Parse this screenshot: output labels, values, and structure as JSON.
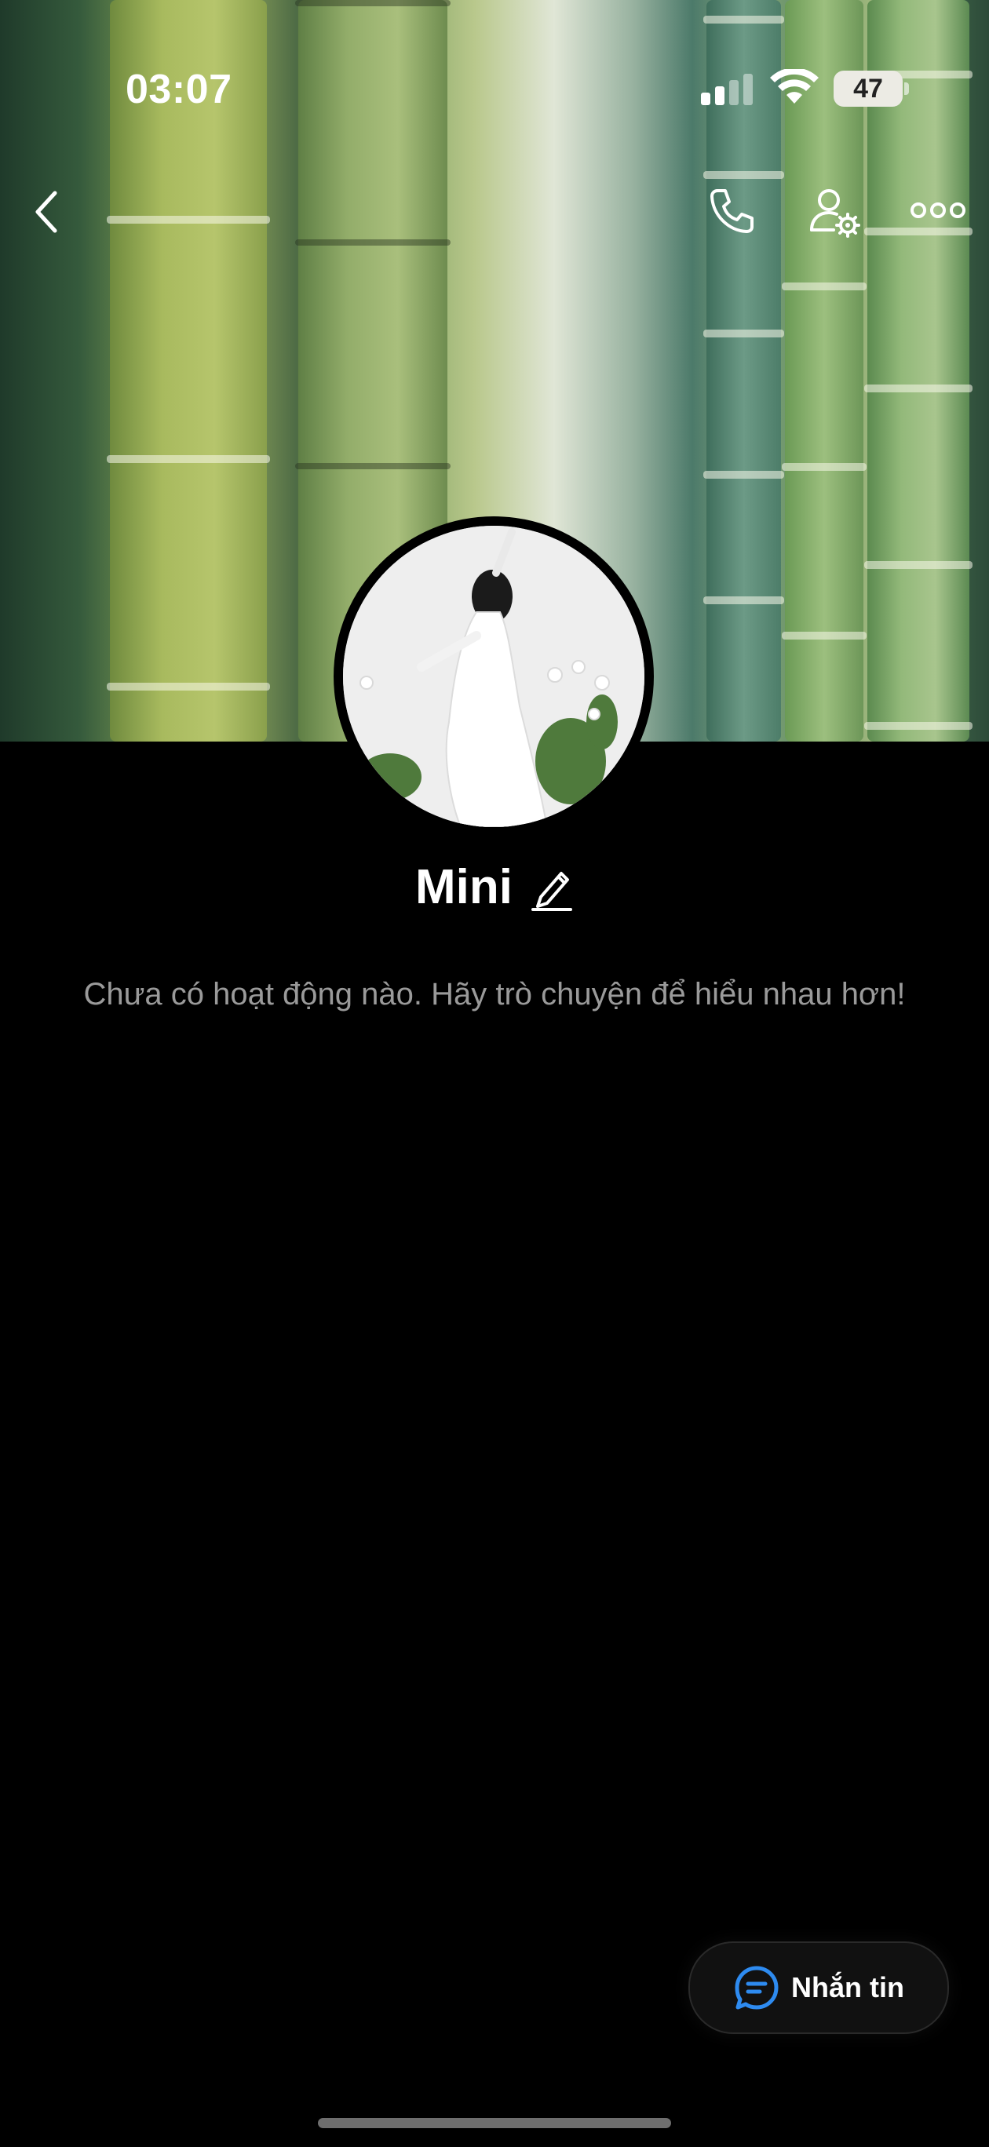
{
  "status_bar": {
    "time": "03:07",
    "battery": "47"
  },
  "profile": {
    "name": "Mini",
    "empty_activity": "Chưa có hoạt động nào. Hãy trò chuyện để hiểu nhau hơn!"
  },
  "actions": {
    "message_label": "Nhắn tin"
  },
  "icons": {
    "back": "chevron-left-icon",
    "call": "phone-icon",
    "settings": "user-settings-icon",
    "more": "more-dots-icon",
    "edit": "pencil-icon",
    "message": "chat-bubble-icon"
  },
  "colors": {
    "accent": "#2E8BF0",
    "muted_text": "#9A9A9A",
    "background": "#000000"
  }
}
